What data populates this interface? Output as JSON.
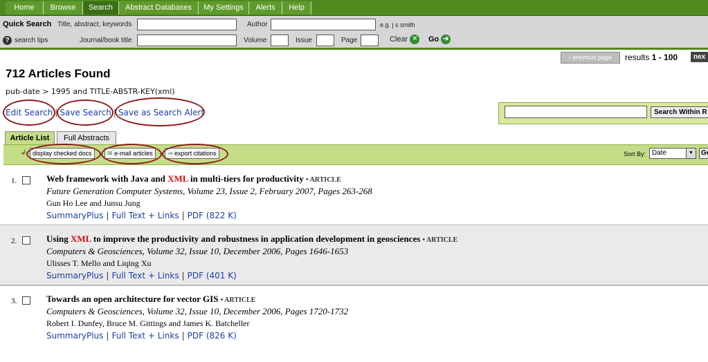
{
  "nav": {
    "tabs": [
      "Home",
      "Browse",
      "Search",
      "Abstract Databases",
      "My Settings",
      "Alerts",
      "Help"
    ],
    "active": "Search"
  },
  "quick_search": {
    "label": "Quick Search",
    "title_label": "Title, abstract, keywords",
    "author_label": "Author",
    "author_hint": "e.g. j s smith",
    "tips_label": "search tips",
    "journal_label": "Journal/book title",
    "volume_label": "Volume",
    "issue_label": "Issue",
    "page_label": "Page",
    "clear_label": "Clear",
    "go_label": "Go"
  },
  "pagination": {
    "prev_label": "‹ previous page",
    "results_prefix": "results",
    "results_range": "1 - 100",
    "next_label": "nex"
  },
  "header": {
    "found": "712 Articles Found",
    "query": "pub-date > 1995 and TITLE-ABSTR-KEY(xml)"
  },
  "actions": {
    "edit": "Edit Search",
    "save": "Save Search",
    "alert": "Save as Search Alert",
    "sep": "|"
  },
  "search_within": {
    "button": "Search Within R"
  },
  "list_tabs": [
    "Article List",
    "Full Abstracts"
  ],
  "toolbar": {
    "display": "display checked docs",
    "email": "e-mail articles",
    "export": "export citations",
    "sort_label": "Sort By:",
    "sort_value": "Date",
    "go": "Go"
  },
  "articles": [
    {
      "num": "1.",
      "title_pre": "Web framework with Java and ",
      "title_hl": "XML",
      "title_post": " in multi-tiers for productivity",
      "type": "• ARTICLE",
      "source": "Future Generation Computer Systems, Volume 23, Issue 2, February 2007, Pages 263-268",
      "authors": "Gun Ho Lee and Junsu Jung",
      "links": [
        "SummaryPlus",
        "Full Text + Links",
        "PDF (822 K)"
      ]
    },
    {
      "num": "2.",
      "title_pre": "Using ",
      "title_hl": "XML",
      "title_post": " to improve the productivity and robustness in application development in geosciences",
      "type": "• ARTICLE",
      "source": "Computers & Geosciences, Volume 32, Issue 10, December 2006, Pages 1646-1653",
      "authors": "Ulisses T. Mello and Liqing Xu",
      "links": [
        "SummaryPlus",
        "Full Text + Links",
        "PDF (401 K)"
      ]
    },
    {
      "num": "3.",
      "title_pre": "Towards an open architecture for vector GIS",
      "title_hl": "",
      "title_post": "",
      "type": "• ARTICLE",
      "source": "Computers & Geosciences, Volume 32, Issue 10, December 2006, Pages 1720-1732",
      "authors": "Robert I. Dunfey, Bruce M. Gittings and James K. Batcheller",
      "links": [
        "SummaryPlus",
        "Full Text + Links",
        "PDF (826 K)"
      ]
    }
  ]
}
